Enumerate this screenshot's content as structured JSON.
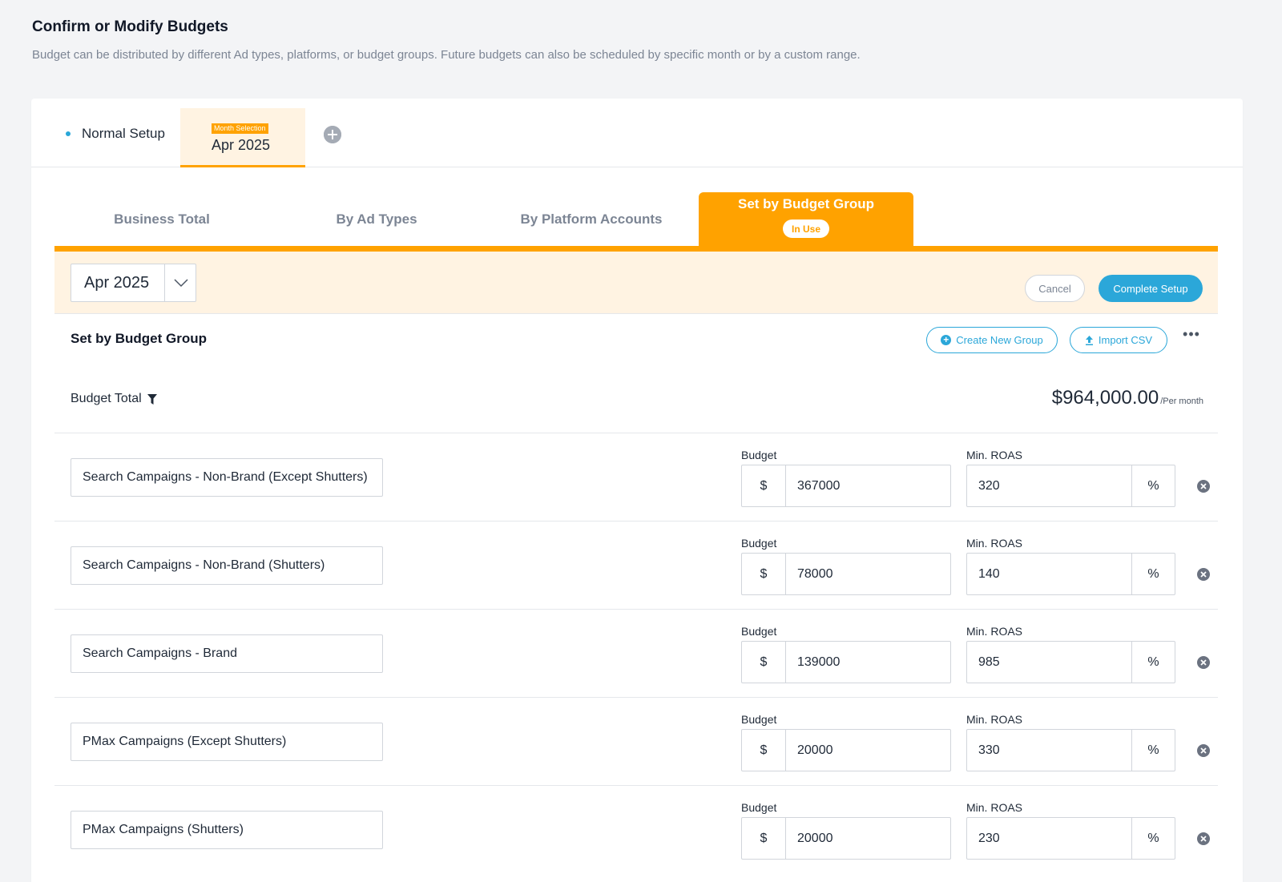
{
  "page": {
    "title": "Confirm or Modify Budgets",
    "subtitle": "Budget can be distributed by different Ad types, platforms, or budget groups. Future budgets can also be scheduled by specific month or by a custom range."
  },
  "setup_tabs": {
    "normal_label": "Normal Setup",
    "month_badge": "Month Selection",
    "month_label": "Apr 2025",
    "add_icon": "plus-circle-icon"
  },
  "method_tabs": {
    "business_total": "Business Total",
    "by_ad_types": "By Ad Types",
    "by_platform_accounts": "By Platform Accounts",
    "set_by_budget_group": "Set by Budget Group",
    "in_use_badge": "In Use"
  },
  "toolbar": {
    "month_value": "Apr 2025",
    "cancel_label": "Cancel",
    "complete_label": "Complete Setup"
  },
  "section": {
    "title": "Set by Budget Group",
    "create_label": "Create New Group",
    "import_label": "Import CSV",
    "more_label": "•••",
    "budget_total_label": "Budget Total",
    "budget_total_value": "$964,000.00",
    "budget_total_unit": "/Per month"
  },
  "labels": {
    "budget": "Budget",
    "min_roas": "Min. ROAS",
    "currency": "$",
    "percent": "%"
  },
  "groups": [
    {
      "name": "Search Campaigns - Non-Brand (Except Shutters)",
      "budget": "367000",
      "roas": "320"
    },
    {
      "name": "Search Campaigns - Non-Brand (Shutters)",
      "budget": "78000",
      "roas": "140"
    },
    {
      "name": "Search Campaigns - Brand",
      "budget": "139000",
      "roas": "985"
    },
    {
      "name": "PMax Campaigns (Except Shutters)",
      "budget": "20000",
      "roas": "330"
    },
    {
      "name": "PMax Campaigns (Shutters)",
      "budget": "20000",
      "roas": "230"
    }
  ],
  "colors": {
    "accent_orange": "#ffa200",
    "accent_blue": "#2ba7d9",
    "toolbar_bg": "#fff3e2"
  }
}
